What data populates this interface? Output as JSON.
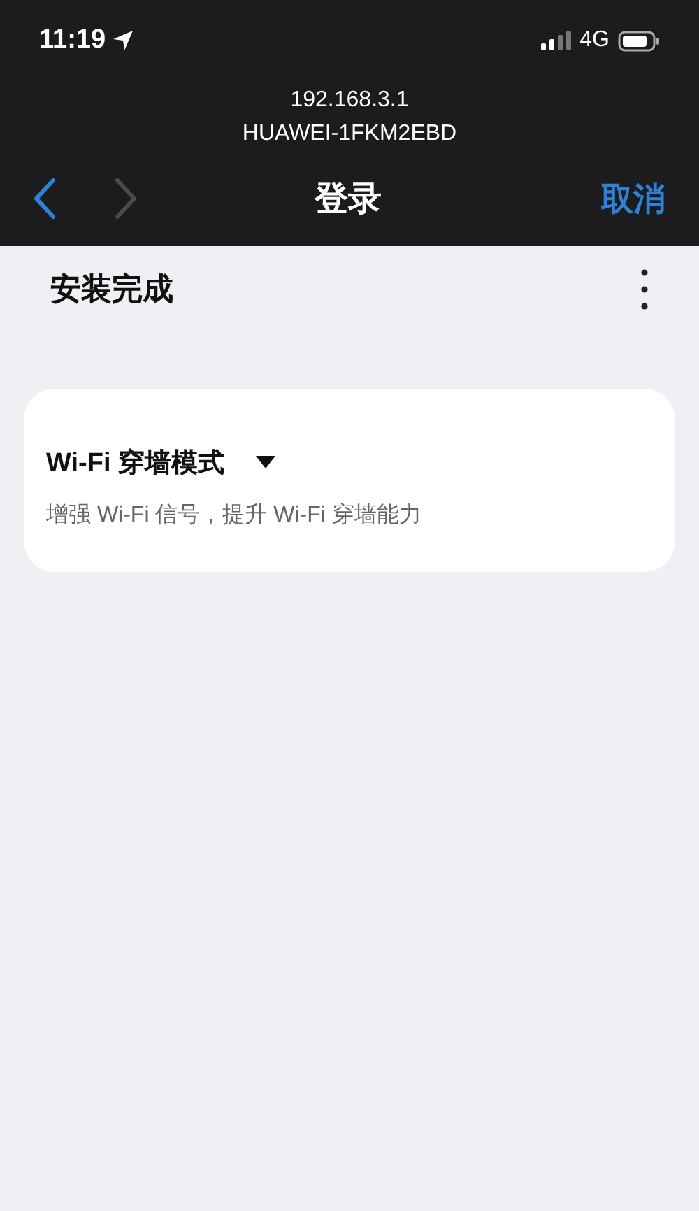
{
  "status_bar": {
    "time": "11:19",
    "network": "4G"
  },
  "address": {
    "host": "192.168.3.1",
    "network_name": "HUAWEI-1FKM2EBD"
  },
  "nav_bar": {
    "back": {
      "disabled": false
    },
    "forward": {
      "disabled": true
    },
    "title": "登录",
    "cancel": "取消"
  },
  "page": {
    "title": "安装完成"
  },
  "card": {
    "title": "Wi-Fi 穿墙模式",
    "description": "增强 Wi-Fi 信号，提升 Wi-Fi 穿墙能力"
  }
}
